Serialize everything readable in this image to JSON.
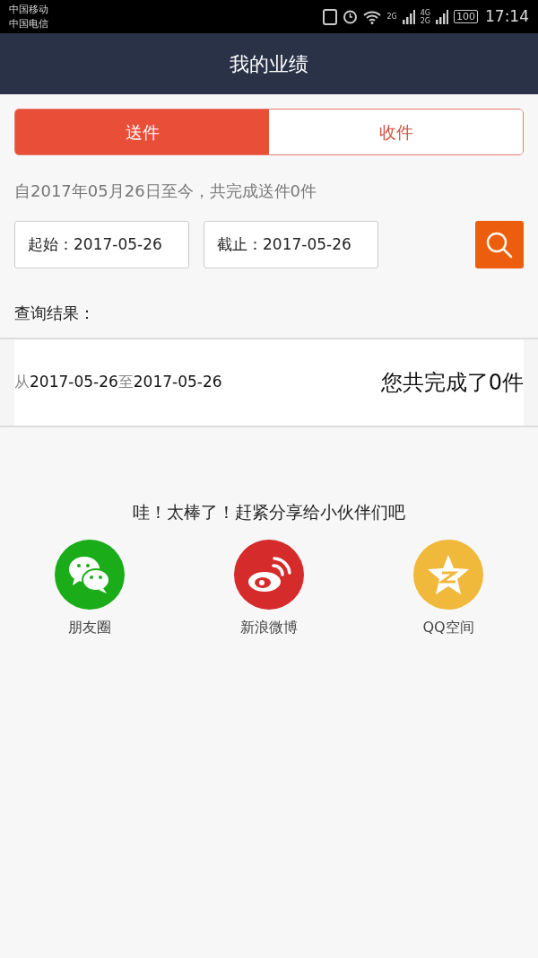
{
  "status_bar": {
    "carriers": [
      "中国移动",
      "中国电信"
    ],
    "network_labels": [
      "2G",
      "4G",
      "2G"
    ],
    "battery": "100",
    "time": "17:14"
  },
  "header": {
    "title": "我的业绩"
  },
  "tabs": [
    {
      "label": "送件",
      "selected": true
    },
    {
      "label": "收件",
      "selected": false
    }
  ],
  "summary": "自2017年05月26日至今，共完成送件0件",
  "filters": [
    {
      "label": "起始：",
      "value": "2017-05-26"
    },
    {
      "label": "截止：",
      "value": "2017-05-26"
    }
  ],
  "results_label": "查询结果：",
  "result": {
    "from_word": "从",
    "start": "2017-05-26",
    "to_word": "至",
    "end": "2017-05-26",
    "total": "您共完成了0件"
  },
  "share": {
    "title": "哇！太棒了！赶紧分享给小伙伴们吧",
    "targets": [
      {
        "kind": "wechat",
        "label": "朋友圈",
        "color": "#1aad19"
      },
      {
        "kind": "weibo",
        "label": "新浪微博",
        "color": "#d52b2b"
      },
      {
        "kind": "qzone",
        "label": "QQ空间",
        "color": "#f1b93b"
      }
    ]
  }
}
